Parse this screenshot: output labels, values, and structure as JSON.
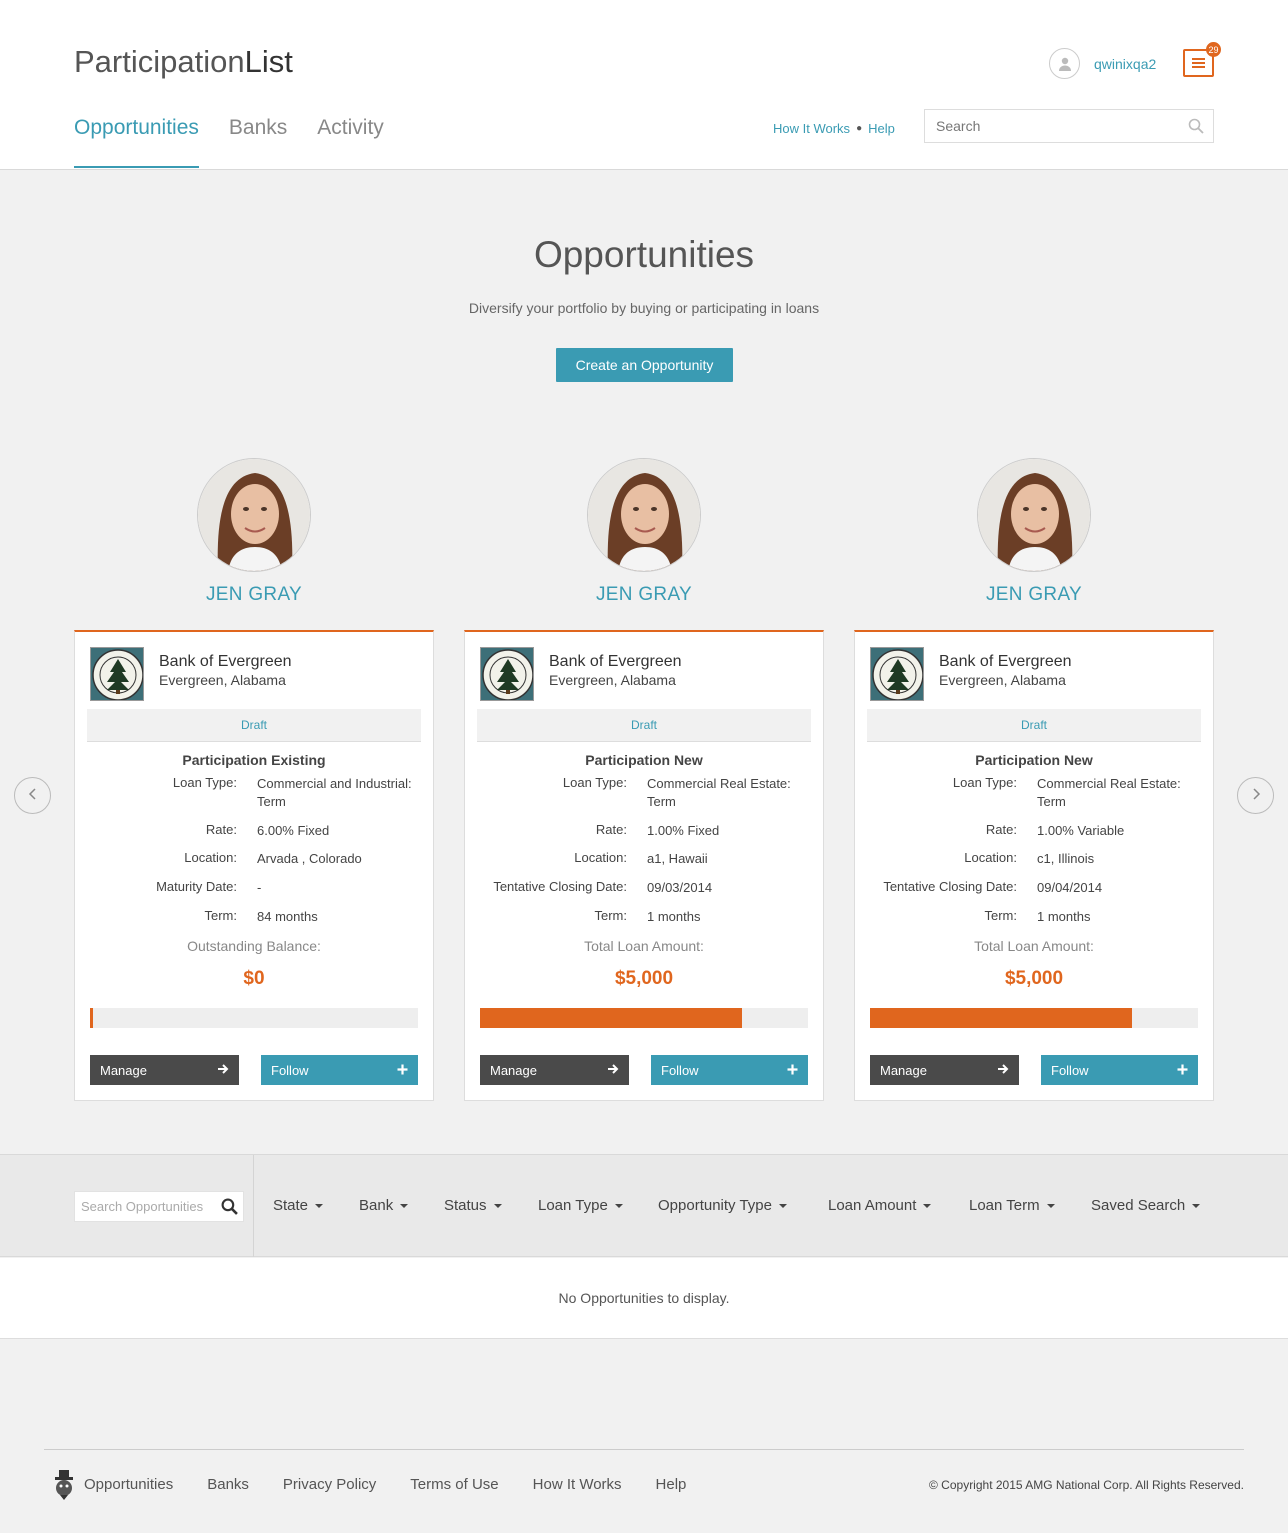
{
  "header": {
    "logo_light": "Participation",
    "logo_strong": "List",
    "username": "qwinixqa2",
    "notification_count": "29",
    "nav": [
      "Opportunities",
      "Banks",
      "Activity"
    ],
    "how_it_works": "How It Works",
    "help": "Help",
    "search_placeholder": "Search"
  },
  "hero": {
    "title": "Opportunities",
    "subtitle": "Diversify your portfolio by buying or participating in loans",
    "create_button": "Create an Opportunity"
  },
  "cards": [
    {
      "person": "JEN GRAY",
      "bank_name": "Bank of Evergreen",
      "bank_location": "Evergreen, Alabama",
      "status": "Draft",
      "type": "Participation Existing",
      "loan_type_label": "Loan Type:",
      "loan_type": "Commercial and Industrial: Term",
      "rate_label": "Rate:",
      "rate": "6.00% Fixed",
      "location_label": "Location:",
      "location": "Arvada , Colorado",
      "date_label": "Maturity Date:",
      "date": "-",
      "term_label": "Term:",
      "term": "84 months",
      "amount_label": "Outstanding Balance:",
      "amount": "$0",
      "progress": 0.01,
      "manage": "Manage",
      "follow": "Follow"
    },
    {
      "person": "JEN GRAY",
      "bank_name": "Bank of Evergreen",
      "bank_location": "Evergreen, Alabama",
      "status": "Draft",
      "type": "Participation New",
      "loan_type_label": "Loan Type:",
      "loan_type": "Commercial Real Estate: Term",
      "rate_label": "Rate:",
      "rate": "1.00% Fixed",
      "location_label": "Location:",
      "location": "a1, Hawaii",
      "date_label": "Tentative Closing Date:",
      "date": "09/03/2014",
      "term_label": "Term:",
      "term": "1 months",
      "amount_label": "Total Loan Amount:",
      "amount": "$5,000",
      "progress": 0.8,
      "manage": "Manage",
      "follow": "Follow"
    },
    {
      "person": "JEN GRAY",
      "bank_name": "Bank of Evergreen",
      "bank_location": "Evergreen, Alabama",
      "status": "Draft",
      "type": "Participation New",
      "loan_type_label": "Loan Type:",
      "loan_type": "Commercial Real Estate: Term",
      "rate_label": "Rate:",
      "rate": "1.00% Variable",
      "location_label": "Location:",
      "location": "c1, Illinois",
      "date_label": "Tentative Closing Date:",
      "date": "09/04/2014",
      "term_label": "Term:",
      "term": "1 months",
      "amount_label": "Total Loan Amount:",
      "amount": "$5,000",
      "progress": 0.8,
      "manage": "Manage",
      "follow": "Follow"
    }
  ],
  "filters": {
    "search_placeholder": "Search Opportunities",
    "items": [
      "State",
      "Bank",
      "Status",
      "Loan Type",
      "Opportunity Type",
      "Loan Amount",
      "Loan Term",
      "Saved Search"
    ]
  },
  "empty_message": "No Opportunities to display.",
  "footer": {
    "links": [
      "Opportunities",
      "Banks",
      "Privacy Policy",
      "Terms of Use",
      "How It Works",
      "Help"
    ],
    "copyright": "© Copyright 2015 AMG National Corp. All Rights Reserved."
  },
  "colors": {
    "accent": "#3a9bb3",
    "orange": "#e0661e",
    "dark_button": "#4a4a4a"
  },
  "icons": [
    "user-icon",
    "menu-icon",
    "search-icon",
    "arrow-right-icon",
    "plus-icon",
    "chevron-left-icon",
    "chevron-right-icon",
    "footer-logo-icon"
  ]
}
